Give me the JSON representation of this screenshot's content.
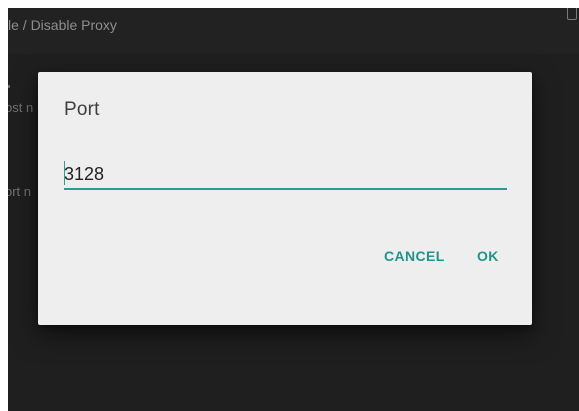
{
  "background": {
    "title_fragment": "",
    "subtitle": "le / Disable Proxy",
    "rows": [
      {
        "text": "ost n"
      },
      {
        "text": "ort n"
      }
    ]
  },
  "dialog": {
    "title": "Port",
    "input_value": "3128",
    "cancel_label": "CANCEL",
    "ok_label": "OK"
  },
  "colors": {
    "accent": "#2a9d91",
    "dialog_bg": "#eeeeee",
    "screen_bg": "#1f1f1f"
  }
}
